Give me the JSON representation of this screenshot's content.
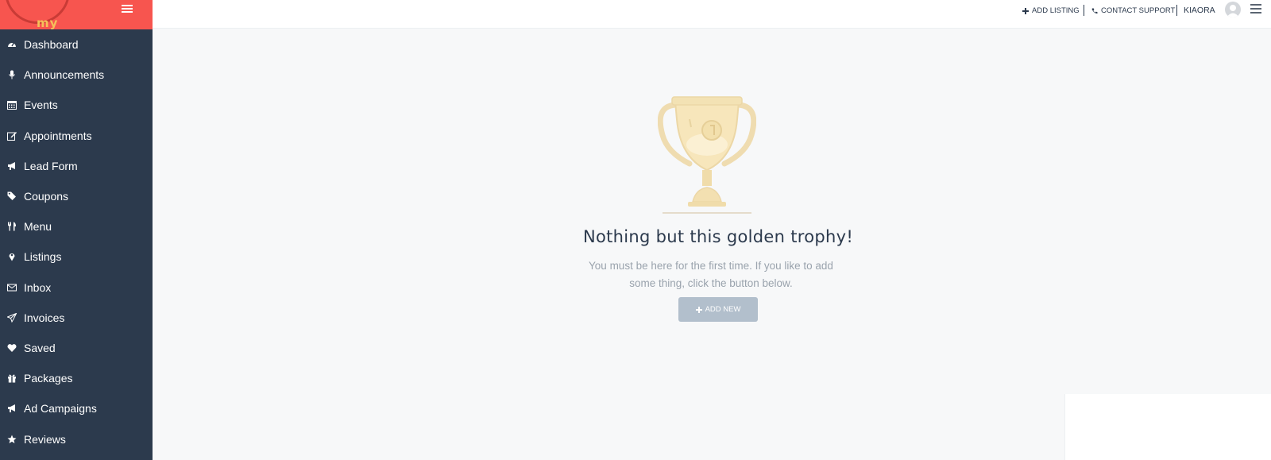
{
  "brand": {
    "logo_text": "my"
  },
  "sidebar": {
    "items": [
      {
        "label": "Dashboard",
        "icon": "dashboard-icon"
      },
      {
        "label": "Announcements",
        "icon": "microphone-icon"
      },
      {
        "label": "Events",
        "icon": "calendar-icon"
      },
      {
        "label": "Appointments",
        "icon": "edit-icon"
      },
      {
        "label": "Lead Form",
        "icon": "bullhorn-icon"
      },
      {
        "label": "Coupons",
        "icon": "tags-icon"
      },
      {
        "label": "Menu",
        "icon": "cutlery-icon"
      },
      {
        "label": "Listings",
        "icon": "map-marker-icon"
      },
      {
        "label": "Inbox",
        "icon": "envelope-icon"
      },
      {
        "label": "Invoices",
        "icon": "paper-plane-icon"
      },
      {
        "label": "Saved",
        "icon": "heart-icon"
      },
      {
        "label": "Packages",
        "icon": "gift-icon"
      },
      {
        "label": "Ad Campaigns",
        "icon": "bullhorn-icon"
      },
      {
        "label": "Reviews",
        "icon": "star-icon"
      }
    ]
  },
  "topbar": {
    "add_listing": "ADD LISTING",
    "contact_support": "CONTACT SUPPORT",
    "user_name": "KIAORA"
  },
  "empty_state": {
    "title": "Nothing but this golden trophy!",
    "description": "You must be here for the first time. If you like to add some thing, click the button below.",
    "button_label": "ADD NEW"
  },
  "colors": {
    "sidebar_bg": "#2c3a4d",
    "logo_bg": "#f7554f",
    "button_bg": "#b2bfcc",
    "title_text": "#2c3a4d"
  }
}
